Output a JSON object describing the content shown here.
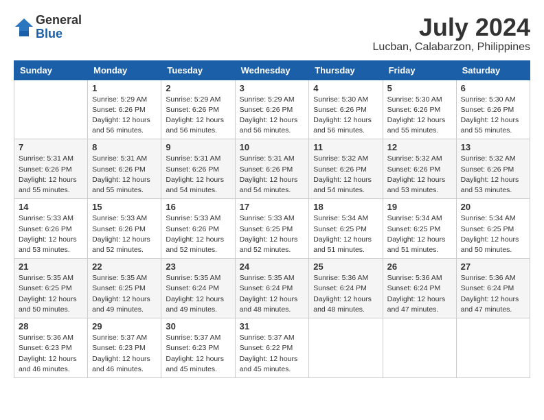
{
  "logo": {
    "general": "General",
    "blue": "Blue"
  },
  "title": {
    "month_year": "July 2024",
    "location": "Lucban, Calabarzon, Philippines"
  },
  "headers": [
    "Sunday",
    "Monday",
    "Tuesday",
    "Wednesday",
    "Thursday",
    "Friday",
    "Saturday"
  ],
  "weeks": [
    [
      {
        "day": "",
        "lines": []
      },
      {
        "day": "1",
        "lines": [
          "Sunrise: 5:29 AM",
          "Sunset: 6:26 PM",
          "Daylight: 12 hours",
          "and 56 minutes."
        ]
      },
      {
        "day": "2",
        "lines": [
          "Sunrise: 5:29 AM",
          "Sunset: 6:26 PM",
          "Daylight: 12 hours",
          "and 56 minutes."
        ]
      },
      {
        "day": "3",
        "lines": [
          "Sunrise: 5:29 AM",
          "Sunset: 6:26 PM",
          "Daylight: 12 hours",
          "and 56 minutes."
        ]
      },
      {
        "day": "4",
        "lines": [
          "Sunrise: 5:30 AM",
          "Sunset: 6:26 PM",
          "Daylight: 12 hours",
          "and 56 minutes."
        ]
      },
      {
        "day": "5",
        "lines": [
          "Sunrise: 5:30 AM",
          "Sunset: 6:26 PM",
          "Daylight: 12 hours",
          "and 55 minutes."
        ]
      },
      {
        "day": "6",
        "lines": [
          "Sunrise: 5:30 AM",
          "Sunset: 6:26 PM",
          "Daylight: 12 hours",
          "and 55 minutes."
        ]
      }
    ],
    [
      {
        "day": "7",
        "lines": [
          "Sunrise: 5:31 AM",
          "Sunset: 6:26 PM",
          "Daylight: 12 hours",
          "and 55 minutes."
        ]
      },
      {
        "day": "8",
        "lines": [
          "Sunrise: 5:31 AM",
          "Sunset: 6:26 PM",
          "Daylight: 12 hours",
          "and 55 minutes."
        ]
      },
      {
        "day": "9",
        "lines": [
          "Sunrise: 5:31 AM",
          "Sunset: 6:26 PM",
          "Daylight: 12 hours",
          "and 54 minutes."
        ]
      },
      {
        "day": "10",
        "lines": [
          "Sunrise: 5:31 AM",
          "Sunset: 6:26 PM",
          "Daylight: 12 hours",
          "and 54 minutes."
        ]
      },
      {
        "day": "11",
        "lines": [
          "Sunrise: 5:32 AM",
          "Sunset: 6:26 PM",
          "Daylight: 12 hours",
          "and 54 minutes."
        ]
      },
      {
        "day": "12",
        "lines": [
          "Sunrise: 5:32 AM",
          "Sunset: 6:26 PM",
          "Daylight: 12 hours",
          "and 53 minutes."
        ]
      },
      {
        "day": "13",
        "lines": [
          "Sunrise: 5:32 AM",
          "Sunset: 6:26 PM",
          "Daylight: 12 hours",
          "and 53 minutes."
        ]
      }
    ],
    [
      {
        "day": "14",
        "lines": [
          "Sunrise: 5:33 AM",
          "Sunset: 6:26 PM",
          "Daylight: 12 hours",
          "and 53 minutes."
        ]
      },
      {
        "day": "15",
        "lines": [
          "Sunrise: 5:33 AM",
          "Sunset: 6:26 PM",
          "Daylight: 12 hours",
          "and 52 minutes."
        ]
      },
      {
        "day": "16",
        "lines": [
          "Sunrise: 5:33 AM",
          "Sunset: 6:26 PM",
          "Daylight: 12 hours",
          "and 52 minutes."
        ]
      },
      {
        "day": "17",
        "lines": [
          "Sunrise: 5:33 AM",
          "Sunset: 6:25 PM",
          "Daylight: 12 hours",
          "and 52 minutes."
        ]
      },
      {
        "day": "18",
        "lines": [
          "Sunrise: 5:34 AM",
          "Sunset: 6:25 PM",
          "Daylight: 12 hours",
          "and 51 minutes."
        ]
      },
      {
        "day": "19",
        "lines": [
          "Sunrise: 5:34 AM",
          "Sunset: 6:25 PM",
          "Daylight: 12 hours",
          "and 51 minutes."
        ]
      },
      {
        "day": "20",
        "lines": [
          "Sunrise: 5:34 AM",
          "Sunset: 6:25 PM",
          "Daylight: 12 hours",
          "and 50 minutes."
        ]
      }
    ],
    [
      {
        "day": "21",
        "lines": [
          "Sunrise: 5:35 AM",
          "Sunset: 6:25 PM",
          "Daylight: 12 hours",
          "and 50 minutes."
        ]
      },
      {
        "day": "22",
        "lines": [
          "Sunrise: 5:35 AM",
          "Sunset: 6:25 PM",
          "Daylight: 12 hours",
          "and 49 minutes."
        ]
      },
      {
        "day": "23",
        "lines": [
          "Sunrise: 5:35 AM",
          "Sunset: 6:24 PM",
          "Daylight: 12 hours",
          "and 49 minutes."
        ]
      },
      {
        "day": "24",
        "lines": [
          "Sunrise: 5:35 AM",
          "Sunset: 6:24 PM",
          "Daylight: 12 hours",
          "and 48 minutes."
        ]
      },
      {
        "day": "25",
        "lines": [
          "Sunrise: 5:36 AM",
          "Sunset: 6:24 PM",
          "Daylight: 12 hours",
          "and 48 minutes."
        ]
      },
      {
        "day": "26",
        "lines": [
          "Sunrise: 5:36 AM",
          "Sunset: 6:24 PM",
          "Daylight: 12 hours",
          "and 47 minutes."
        ]
      },
      {
        "day": "27",
        "lines": [
          "Sunrise: 5:36 AM",
          "Sunset: 6:24 PM",
          "Daylight: 12 hours",
          "and 47 minutes."
        ]
      }
    ],
    [
      {
        "day": "28",
        "lines": [
          "Sunrise: 5:36 AM",
          "Sunset: 6:23 PM",
          "Daylight: 12 hours",
          "and 46 minutes."
        ]
      },
      {
        "day": "29",
        "lines": [
          "Sunrise: 5:37 AM",
          "Sunset: 6:23 PM",
          "Daylight: 12 hours",
          "and 46 minutes."
        ]
      },
      {
        "day": "30",
        "lines": [
          "Sunrise: 5:37 AM",
          "Sunset: 6:23 PM",
          "Daylight: 12 hours",
          "and 45 minutes."
        ]
      },
      {
        "day": "31",
        "lines": [
          "Sunrise: 5:37 AM",
          "Sunset: 6:22 PM",
          "Daylight: 12 hours",
          "and 45 minutes."
        ]
      },
      {
        "day": "",
        "lines": []
      },
      {
        "day": "",
        "lines": []
      },
      {
        "day": "",
        "lines": []
      }
    ]
  ]
}
